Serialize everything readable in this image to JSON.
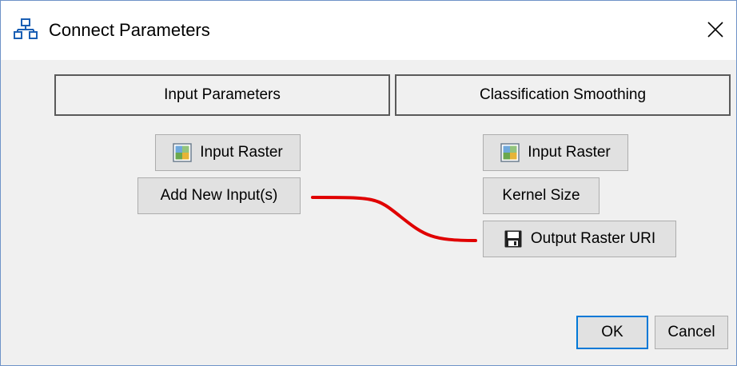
{
  "window": {
    "title": "Connect Parameters"
  },
  "left_panel": {
    "header": "Input Parameters",
    "items": [
      {
        "label": "Input Raster",
        "icon": "raster-image-icon"
      },
      {
        "label": "Add New Input(s)"
      }
    ]
  },
  "right_panel": {
    "header": "Classification Smoothing",
    "items": [
      {
        "label": "Input Raster",
        "icon": "raster-image-icon"
      },
      {
        "label": "Kernel Size"
      },
      {
        "label": "Output Raster URI",
        "icon": "save-disk-icon"
      }
    ]
  },
  "connection": {
    "from": "Add New Input(s)",
    "to": "Output Raster URI",
    "color": "#e00000"
  },
  "footer": {
    "ok_label": "OK",
    "cancel_label": "Cancel"
  }
}
